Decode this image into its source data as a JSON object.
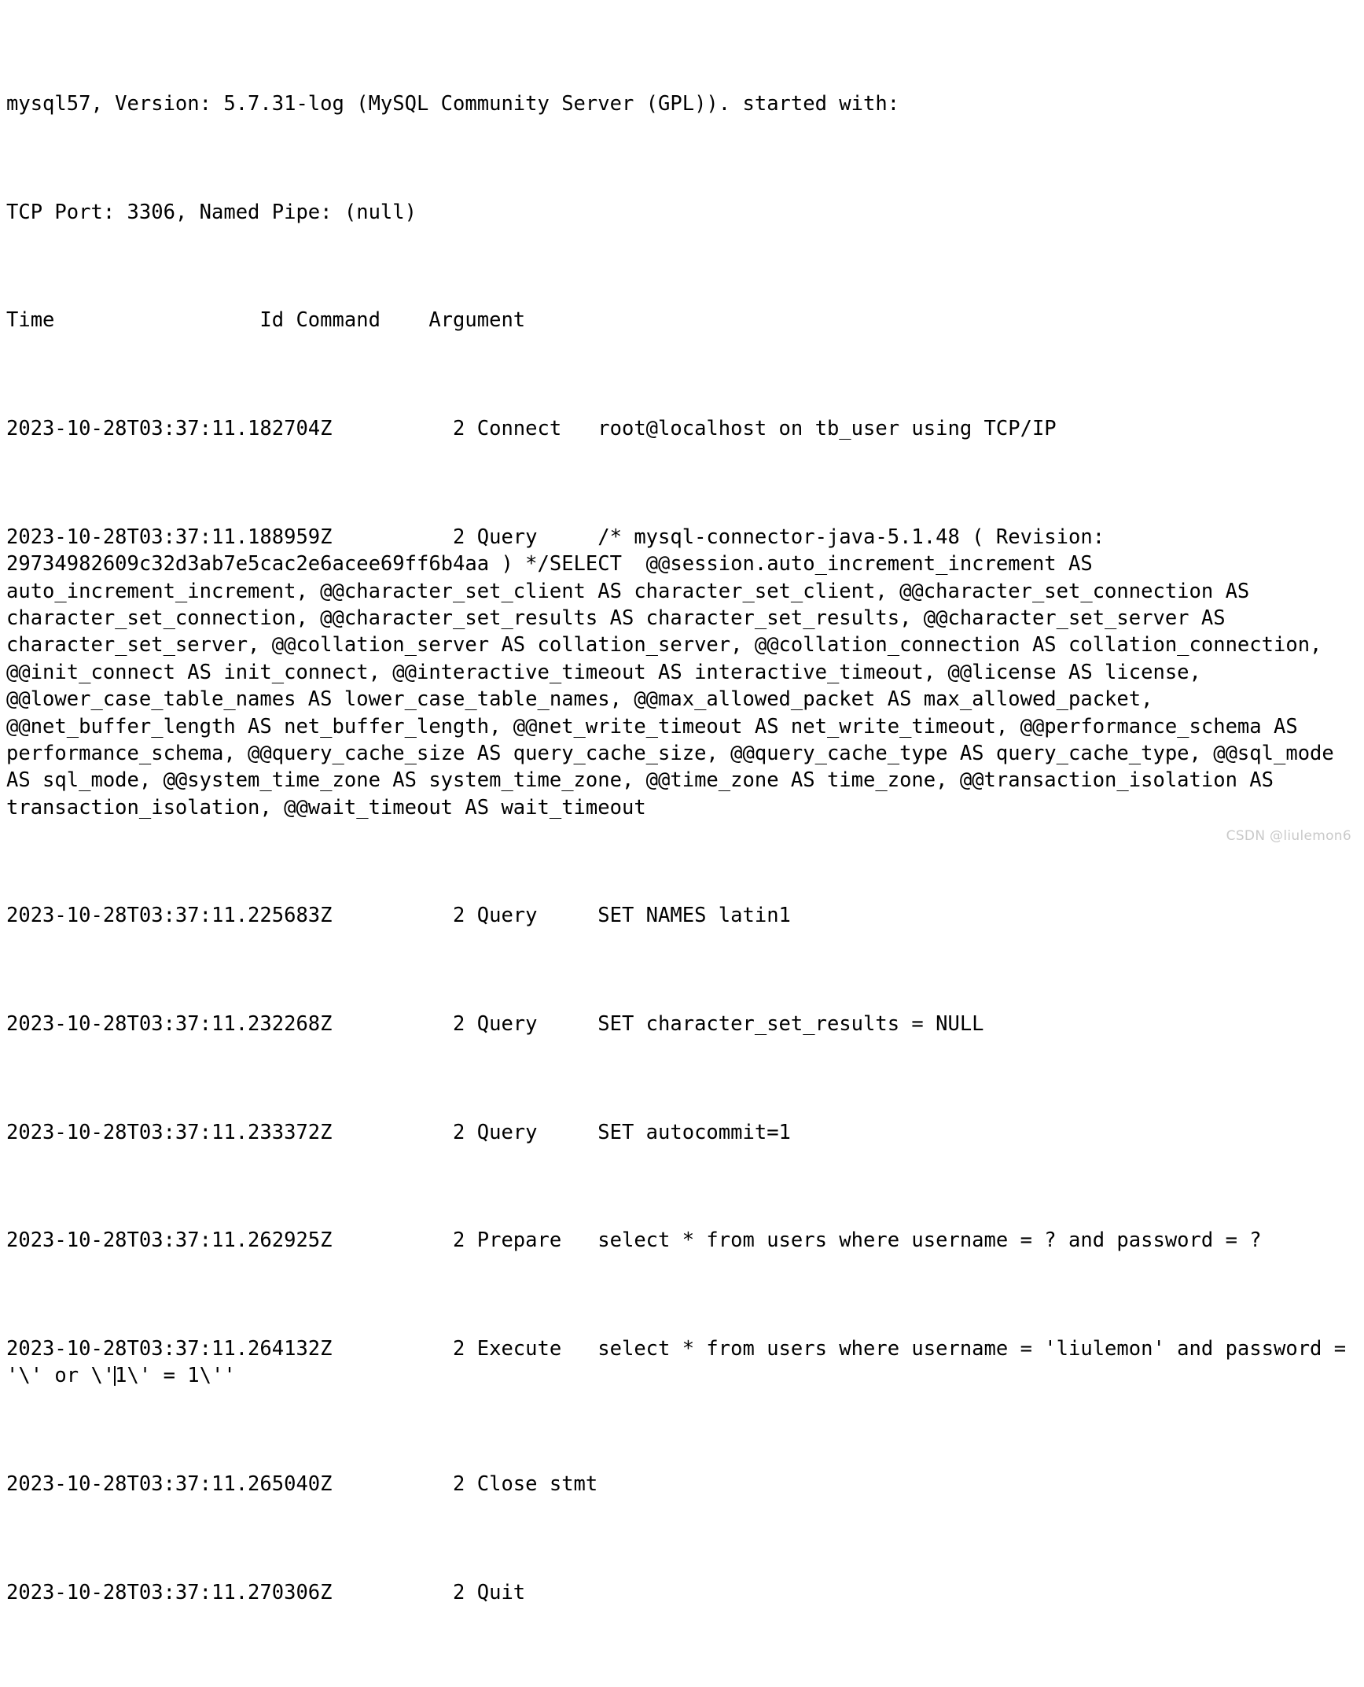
{
  "colors": {
    "background": "#ffffff",
    "text": "#000000",
    "watermark": "#c9c9c9"
  },
  "log": {
    "header": {
      "banner": "mysql57, Version: 5.7.31-log (MySQL Community Server (GPL)). started with:",
      "connection_info": "TCP Port: 3306, Named Pipe: (null)",
      "columns": "Time                 Id Command    Argument"
    },
    "column_headers": [
      "Time",
      "Id",
      "Command",
      "Argument"
    ],
    "entries": [
      {
        "time": "2023-10-28T03:37:11.182704Z",
        "id": "2",
        "command": "Connect",
        "argument": "root@localhost on tb_user using TCP/IP",
        "raw": "2023-10-28T03:37:11.182704Z\t    2 Connect\troot@localhost on tb_user using TCP/IP"
      },
      {
        "time": "2023-10-28T03:37:11.188959Z",
        "id": "2",
        "command": "Query",
        "argument": "/* mysql-connector-java-5.1.48 ( Revision: 29734982609c32d3ab7e5cac2e6acee69ff6b4aa ) */SELECT  @@session.auto_increment_increment AS auto_increment_increment, @@character_set_client AS character_set_client, @@character_set_connection AS character_set_connection, @@character_set_results AS character_set_results, @@character_set_server AS character_set_server, @@collation_server AS collation_server, @@collation_connection AS collation_connection, @@init_connect AS init_connect, @@interactive_timeout AS interactive_timeout, @@license AS license, @@lower_case_table_names AS lower_case_table_names, @@max_allowed_packet AS max_allowed_packet, @@net_buffer_length AS net_buffer_length, @@net_write_timeout AS net_write_timeout, @@performance_schema AS performance_schema, @@query_cache_size AS query_cache_size, @@query_cache_type AS query_cache_type, @@sql_mode AS sql_mode, @@system_time_zone AS system_time_zone, @@time_zone AS time_zone, @@transaction_isolation AS transaction_isolation, @@wait_timeout AS wait_timeout",
        "raw": "2023-10-28T03:37:11.188959Z\t    2 Query\t/* mysql-connector-java-5.1.48 ( Revision: 29734982609c32d3ab7e5cac2e6acee69ff6b4aa ) */SELECT  @@session.auto_increment_increment AS auto_increment_increment, @@character_set_client AS character_set_client, @@character_set_connection AS character_set_connection, @@character_set_results AS character_set_results, @@character_set_server AS character_set_server, @@collation_server AS collation_server, @@collation_connection AS collation_connection, @@init_connect AS init_connect, @@interactive_timeout AS interactive_timeout, @@license AS license, @@lower_case_table_names AS lower_case_table_names, @@max_allowed_packet AS max_allowed_packet, @@net_buffer_length AS net_buffer_length, @@net_write_timeout AS net_write_timeout, @@performance_schema AS performance_schema, @@query_cache_size AS query_cache_size, @@query_cache_type AS query_cache_type, @@sql_mode AS sql_mode, @@system_time_zone AS system_time_zone, @@time_zone AS time_zone, @@transaction_isolation AS transaction_isolation, @@wait_timeout AS wait_timeout"
      },
      {
        "time": "2023-10-28T03:37:11.225683Z",
        "id": "2",
        "command": "Query",
        "argument": "SET NAMES latin1",
        "raw": "2023-10-28T03:37:11.225683Z\t    2 Query\tSET NAMES latin1"
      },
      {
        "time": "2023-10-28T03:37:11.232268Z",
        "id": "2",
        "command": "Query",
        "argument": "SET character_set_results = NULL",
        "raw": "2023-10-28T03:37:11.232268Z\t    2 Query\tSET character_set_results = NULL"
      },
      {
        "time": "2023-10-28T03:37:11.233372Z",
        "id": "2",
        "command": "Query",
        "argument": "SET autocommit=1",
        "raw": "2023-10-28T03:37:11.233372Z\t    2 Query\tSET autocommit=1"
      },
      {
        "time": "2023-10-28T03:37:11.262925Z",
        "id": "2",
        "command": "Prepare",
        "argument": "select * from users where username = ? and password = ?",
        "raw": "2023-10-28T03:37:11.262925Z\t    2 Prepare\tselect * from users where username = ? and password = ?"
      },
      {
        "time": "2023-10-28T03:37:11.264132Z",
        "id": "2",
        "command": "Execute",
        "argument": "select * from users where username = 'liulemon' and password = '\\' or \\'1\\' = 1\\''",
        "raw": "2023-10-28T03:37:11.264132Z\t    2 Execute\tselect * from users where username = 'liulemon' and password = '\\' or \\'1\\' = 1\\''",
        "has_caret": true
      },
      {
        "time": "2023-10-28T03:37:11.265040Z",
        "id": "2",
        "command": "Close stmt",
        "argument": "",
        "raw": "2023-10-28T03:37:11.265040Z\t    2 Close stmt"
      },
      {
        "time": "2023-10-28T03:37:11.270306Z",
        "id": "2",
        "command": "Quit",
        "argument": "",
        "raw": "2023-10-28T03:37:11.270306Z\t    2 Quit"
      }
    ],
    "rendered_lines": [
      "mysql57, Version: 5.7.31-log (MySQL Community Server (GPL)). started with:",
      "TCP Port: 3306, Named Pipe: (null)",
      "Time                 Id Command    Argument",
      "2023-10-28T03:37:11.182704Z          2 Connect   root@localhost on tb_user using TCP/IP",
      "2023-10-28T03:37:11.188959Z          2 Query     /* mysql-connector-java-5.1.48 ( Revision: 29734982609c32d3ab7e5cac2e6acee69ff6b4aa ) */SELECT  @@session.auto_increment_increment AS auto_increment_increment, @@character_set_client AS character_set_client, @@character_set_connection AS character_set_connection, @@character_set_results AS character_set_results, @@character_set_server AS character_set_server, @@collation_server AS collation_server, @@collation_connection AS collation_connection, @@init_connect AS init_connect, @@interactive_timeout AS interactive_timeout, @@license AS license, @@lower_case_table_names AS lower_case_table_names, @@max_allowed_packet AS max_allowed_packet, @@net_buffer_length AS net_buffer_length, @@net_write_timeout AS net_write_timeout, @@performance_schema AS performance_schema, @@query_cache_size AS query_cache_size, @@query_cache_type AS query_cache_type, @@sql_mode AS sql_mode, @@system_time_zone AS system_time_zone, @@time_zone AS time_zone, @@transaction_isolation AS transaction_isolation, @@wait_timeout AS wait_timeout",
      "2023-10-28T03:37:11.225683Z          2 Query     SET NAMES latin1",
      "2023-10-28T03:37:11.232268Z          2 Query     SET character_set_results = NULL",
      "2023-10-28T03:37:11.233372Z          2 Query     SET autocommit=1",
      "2023-10-28T03:37:11.262925Z          2 Prepare   select * from users where username = ? and password = ?",
      "2023-10-28T03:37:11.264132Z          2 Execute   select * from users where username = 'liulemon' and password = '\\' or \\'1\\' = 1\\''",
      "2023-10-28T03:37:11.265040Z          2 Close stmt",
      "2023-10-28T03:37:11.270306Z          2 Quit"
    ],
    "execute_line_parts": {
      "before_caret": "2023-10-28T03:37:11.264132Z          2 Execute   select * from users where username = 'liulemon' and password = '\\' or \\'",
      "after_caret": "1\\' = 1\\''"
    }
  },
  "watermark": "CSDN @liulemon6"
}
